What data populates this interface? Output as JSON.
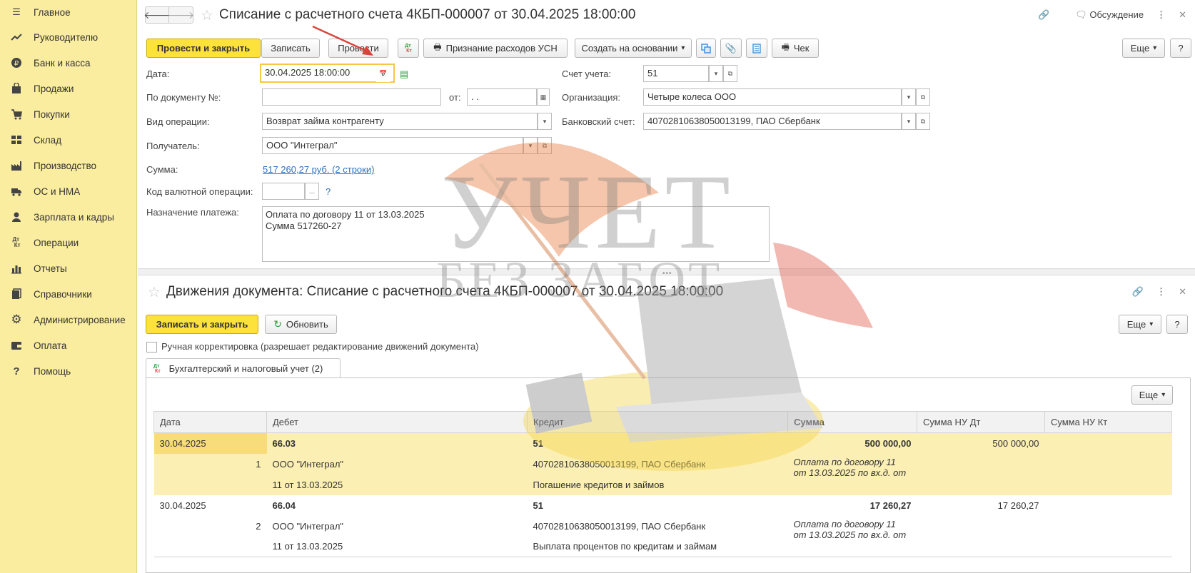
{
  "sidebar": {
    "items": [
      {
        "label": "Главное",
        "icon": "menu-icon"
      },
      {
        "label": "Руководителю",
        "icon": "trend-icon"
      },
      {
        "label": "Банк и касса",
        "icon": "coin-icon"
      },
      {
        "label": "Продажи",
        "icon": "bag-icon"
      },
      {
        "label": "Покупки",
        "icon": "cart-icon"
      },
      {
        "label": "Склад",
        "icon": "warehouse-icon"
      },
      {
        "label": "Производство",
        "icon": "factory-icon"
      },
      {
        "label": "ОС и НМА",
        "icon": "truck-icon"
      },
      {
        "label": "Зарплата и кадры",
        "icon": "person-icon"
      },
      {
        "label": "Операции",
        "icon": "dt-kt-icon"
      },
      {
        "label": "Отчеты",
        "icon": "bar-chart-icon"
      },
      {
        "label": "Справочники",
        "icon": "books-icon"
      },
      {
        "label": "Администрирование",
        "icon": "gear-icon"
      },
      {
        "label": "Оплата",
        "icon": "wallet-icon"
      },
      {
        "label": "Помощь",
        "icon": "help-icon"
      }
    ]
  },
  "doc": {
    "title": "Списание с расчетного счета 4КБП-000007 от 30.04.2025 18:00:00",
    "discussion": "Обсуждение",
    "toolbar": {
      "post_close": "Провести и закрыть",
      "save": "Записать",
      "post": "Провести",
      "usn": "Признание расходов УСН",
      "create_based": "Создать на основании",
      "check": "Чек",
      "more": "Еще",
      "help": "?"
    },
    "fields": {
      "date_label": "Дата:",
      "date_value": "30.04.2025 18:00:00",
      "docnum_label": "По документу №:",
      "docnum_value": "",
      "from_label": "от:",
      "from_value": " .  . ",
      "optype_label": "Вид операции:",
      "optype_value": "Возврат займа контрагенту",
      "recipient_label": "Получатель:",
      "recipient_value": "ООО \"Интеграл\"",
      "sum_label": "Сумма:",
      "sum_value": "517 260,27 руб. (2 строки)",
      "currency_label": "Код валютной операции:",
      "currency_value": "",
      "currency_help": "?",
      "purpose_label": "Назначение платежа:",
      "purpose_line1": "Оплата по договору 11 от 13.03.2025",
      "purpose_line2": "Сумма 517260-27",
      "account_label": "Счет учета:",
      "account_value": "51",
      "org_label": "Организация:",
      "org_value": "Четыре колеса ООО",
      "bank_label": "Банковский счет:",
      "bank_value": "40702810638050013199, ПАО Сбербанк"
    }
  },
  "movements": {
    "title": "Движения документа: Списание с расчетного счета 4КБП-000007 от 30.04.2025 18:00:00",
    "save_close": "Записать и закрыть",
    "refresh": "Обновить",
    "more": "Еще",
    "help": "?",
    "manual_label": "Ручная корректировка (разрешает редактирование движений документа)",
    "tab_label": "Бухгалтерский и налоговый учет (2)",
    "grid_more": "Еще",
    "columns": [
      "Дата",
      "Дебет",
      "Кредит",
      "Сумма",
      "Сумма НУ Дт",
      "Сумма НУ Кт"
    ],
    "rows": [
      {
        "date": "30.04.2025",
        "num": "1",
        "debit": "66.03",
        "debit_sub1": "ООО \"Интеграл\"",
        "debit_sub2": "11 от 13.03.2025",
        "credit": "51",
        "credit_sub1": "40702810638050013199, ПАО Сбербанк",
        "credit_sub2": "Погашение кредитов и займов",
        "sum": "500 000,00",
        "sum_nu_dt": "500 000,00",
        "sum_nu_kt": "",
        "note": "Оплата по договору 11 от 13.03.2025 по вх.д. от"
      },
      {
        "date": "30.04.2025",
        "num": "2",
        "debit": "66.04",
        "debit_sub1": "ООО \"Интеграл\"",
        "debit_sub2": "11 от 13.03.2025",
        "credit": "51",
        "credit_sub1": "40702810638050013199, ПАО Сбербанк",
        "credit_sub2": "Выплата процентов по кредитам и займам",
        "sum": "17 260,27",
        "sum_nu_dt": "17 260,27",
        "sum_nu_kt": "",
        "note": "Оплата по договору 11 от 13.03.2025 по вх.д. от"
      }
    ]
  },
  "watermark": {
    "line1": "УЧЕТ",
    "line2": "БЕЗ ЗАБОТ"
  },
  "colors": {
    "accent_yellow": "#fce23a",
    "sidebar_bg": "#fbeda0",
    "link": "#2f6fb8",
    "selected_row": "#fbefb3"
  }
}
